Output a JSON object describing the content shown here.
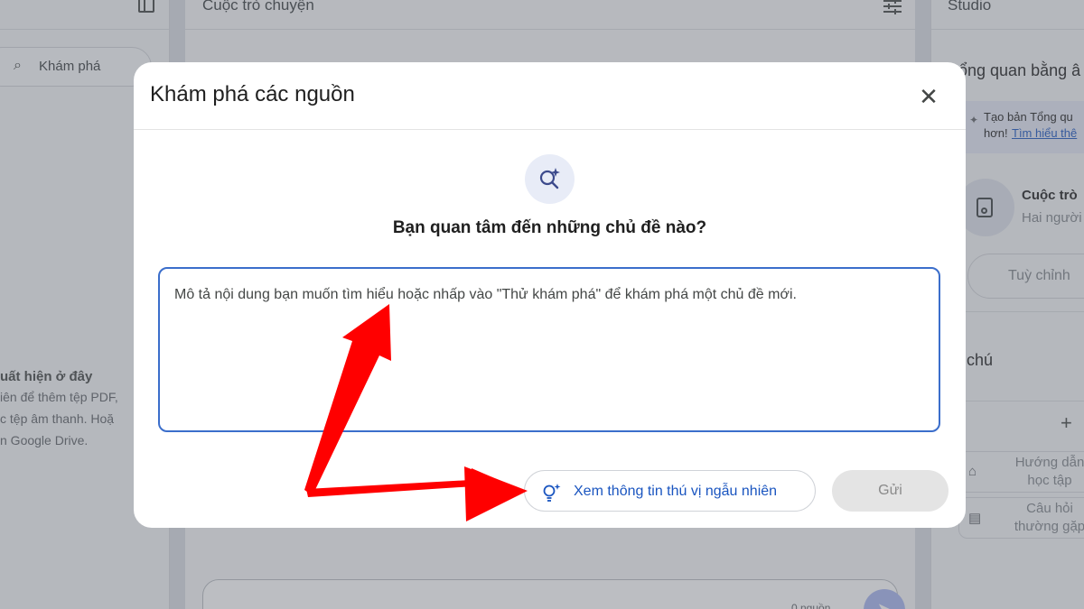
{
  "left_panel": {
    "explore_label": "Khám phá",
    "empty_title": "uất hiện ở đây",
    "empty_lines": [
      "iên để thêm tệp PDF,",
      "c tệp âm thanh. Hoặ",
      "n Google Drive."
    ]
  },
  "center_panel": {
    "header": "Cuộc trò chuyện",
    "source_count": "0 nguồn"
  },
  "right_panel": {
    "header": "Studio",
    "overview_heading": "ổng quan bằng â",
    "banner_line1": "Tạo bản Tổng qu",
    "banner_line2_prefix": "hơn!",
    "banner_link": "Tìm hiểu thê",
    "conversation_title": "Cuộc trò",
    "conversation_sub": "Hai người",
    "customize_button": "Tuỳ chỉnh",
    "notes_heading": "i chú",
    "add_note": "+",
    "study_guide_line1": "Hướng dẫn",
    "study_guide_line2": "học tập",
    "faq_line1": "Câu hỏi",
    "faq_line2": "thường gặp"
  },
  "dialog": {
    "title": "Khám phá các nguồn",
    "close": "✕",
    "question": "Bạn quan tâm đến những chủ đề nào?",
    "textarea_placeholder": "Mô tả nội dung bạn muốn tìm hiểu hoặc nhấp vào \"Thử khám phá\" để khám phá một chủ đề mới.",
    "random_button": "Xem thông tin thú vị ngẫu nhiên",
    "send_button": "Gửi"
  },
  "icons": {
    "explore": "sparkle-search-icon",
    "random": "lightbulb-sparkle-icon",
    "send": "send-icon"
  },
  "colors": {
    "accent": "#1a55c0",
    "textarea_border": "#3b6ecb",
    "annotation_arrow": "#ff0000"
  }
}
